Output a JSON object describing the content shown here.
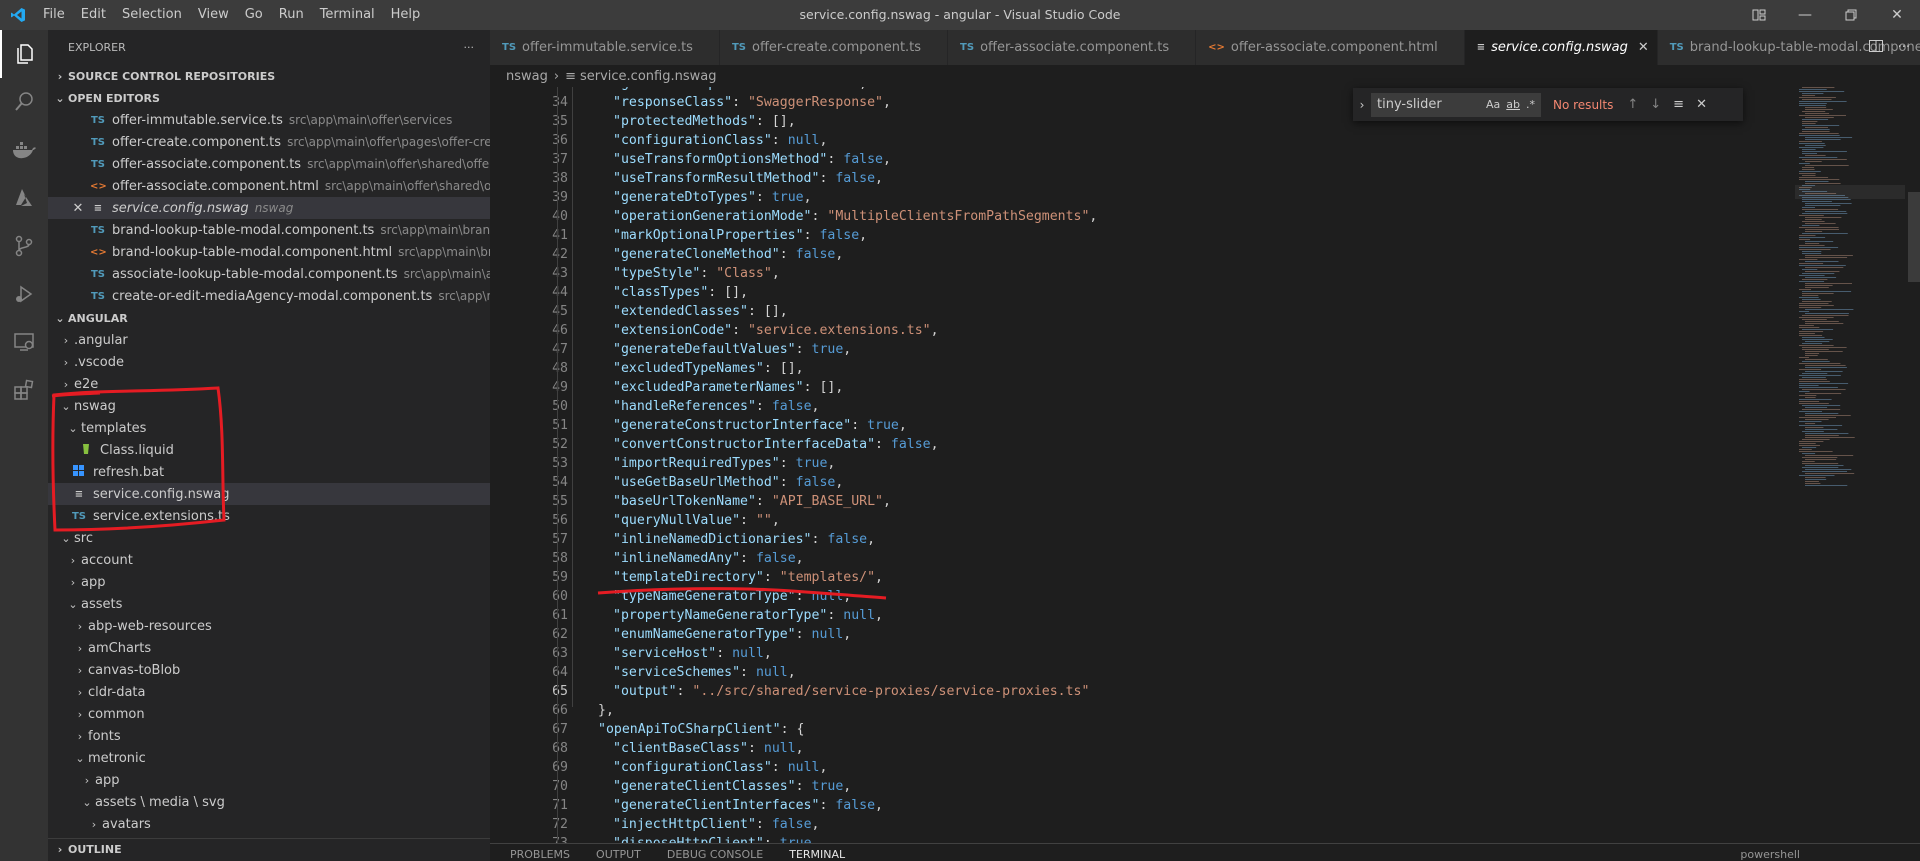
{
  "titlebar": {
    "menu": [
      "File",
      "Edit",
      "Selection",
      "View",
      "Go",
      "Run",
      "Terminal",
      "Help"
    ],
    "title": "service.config.nswag - angular - Visual Studio Code"
  },
  "sidebar": {
    "title": "EXPLORER",
    "more": "···",
    "sections": {
      "scm": "SOURCE CONTROL REPOSITORIES",
      "open_editors": "OPEN EDITORS",
      "workspace": "ANGULAR",
      "outline": "OUTLINE"
    },
    "open_editors": [
      {
        "icon": "TS",
        "name": "offer-immutable.service.ts",
        "path": "src\\app\\main\\offer\\services"
      },
      {
        "icon": "TS",
        "name": "offer-create.component.ts",
        "path": "src\\app\\main\\offer\\pages\\offer-create"
      },
      {
        "icon": "TS",
        "name": "offer-associate.component.ts",
        "path": "src\\app\\main\\offer\\shared\\offer-asso..."
      },
      {
        "icon": "<>",
        "name": "offer-associate.component.html",
        "path": "src\\app\\main\\offer\\shared\\offer-a..."
      },
      {
        "icon": "≡",
        "name": "service.config.nswag",
        "path": "nswag"
      },
      {
        "icon": "TS",
        "name": "brand-lookup-table-modal.component.ts",
        "path": "src\\app\\main\\brand\\sha..."
      },
      {
        "icon": "<>",
        "name": "brand-lookup-table-modal.component.html",
        "path": "src\\app\\main\\brand\\..."
      },
      {
        "icon": "TS",
        "name": "associate-lookup-table-modal.component.ts",
        "path": "src\\app\\main\\associ..."
      },
      {
        "icon": "TS",
        "name": "create-or-edit-mediaAgency-modal.component.ts",
        "path": "src\\app\\main\\..."
      }
    ],
    "tree": [
      {
        "depth": 0,
        "chev": "›",
        "label": ".angular"
      },
      {
        "depth": 0,
        "chev": "›",
        "label": ".vscode"
      },
      {
        "depth": 0,
        "chev": "›",
        "label": "e2e"
      },
      {
        "depth": 0,
        "chev": "⌄",
        "label": "nswag"
      },
      {
        "depth": 1,
        "chev": "⌄",
        "label": "templates"
      },
      {
        "depth": 2,
        "chev": "",
        "label": "Class.liquid",
        "icon": "liquid"
      },
      {
        "depth": 1,
        "chev": "",
        "label": "refresh.bat",
        "icon": "bat"
      },
      {
        "depth": 1,
        "chev": "",
        "label": "service.config.nswag",
        "icon": "cfg",
        "selected": true
      },
      {
        "depth": 1,
        "chev": "",
        "label": "service.extensions.ts",
        "icon": "ts"
      },
      {
        "depth": 0,
        "chev": "⌄",
        "label": "src"
      },
      {
        "depth": 1,
        "chev": "›",
        "label": "account"
      },
      {
        "depth": 1,
        "chev": "›",
        "label": "app"
      },
      {
        "depth": 1,
        "chev": "⌄",
        "label": "assets"
      },
      {
        "depth": 2,
        "chev": "›",
        "label": "abp-web-resources"
      },
      {
        "depth": 2,
        "chev": "›",
        "label": "amCharts"
      },
      {
        "depth": 2,
        "chev": "›",
        "label": "canvas-toBlob"
      },
      {
        "depth": 2,
        "chev": "›",
        "label": "cldr-data"
      },
      {
        "depth": 2,
        "chev": "›",
        "label": "common"
      },
      {
        "depth": 2,
        "chev": "›",
        "label": "fonts"
      },
      {
        "depth": 2,
        "chev": "⌄",
        "label": "metronic"
      },
      {
        "depth": 3,
        "chev": "›",
        "label": "app"
      },
      {
        "depth": 3,
        "chev": "⌄",
        "label": "assets \\ media \\ svg"
      },
      {
        "depth": 4,
        "chev": "›",
        "label": "avatars"
      }
    ]
  },
  "tabs": [
    {
      "icon": "TS",
      "label": "offer-immutable.service.ts"
    },
    {
      "icon": "TS",
      "label": "offer-create.component.ts"
    },
    {
      "icon": "TS",
      "label": "offer-associate.component.ts"
    },
    {
      "icon": "<>",
      "label": "offer-associate.component.html"
    },
    {
      "icon": "≡",
      "label": "service.config.nswag",
      "active": true
    },
    {
      "icon": "TS",
      "label": "brand-lookup-table-modal.component.ts"
    }
  ],
  "breadcrumbs": [
    "nswag",
    "service.config.nswag"
  ],
  "find": {
    "query": "tiny-slider",
    "opt_case": "Aa",
    "opt_word": "ab",
    "opt_regex": ".*",
    "result": "No results"
  },
  "editor": {
    "current_line": 65,
    "lines": [
      {
        "n": "33",
        "i": 1,
        "t": "\"generateResponseClasses\": true,"
      },
      {
        "n": "34",
        "i": 1,
        "t": "\"responseClass\": \"SwaggerResponse\","
      },
      {
        "n": "35",
        "i": 1,
        "t": "\"protectedMethods\": [],"
      },
      {
        "n": "36",
        "i": 1,
        "t": "\"configurationClass\": null,"
      },
      {
        "n": "37",
        "i": 1,
        "t": "\"useTransformOptionsMethod\": false,"
      },
      {
        "n": "38",
        "i": 1,
        "t": "\"useTransformResultMethod\": false,"
      },
      {
        "n": "39",
        "i": 1,
        "t": "\"generateDtoTypes\": true,"
      },
      {
        "n": "40",
        "i": 1,
        "t": "\"operationGenerationMode\": \"MultipleClientsFromPathSegments\","
      },
      {
        "n": "41",
        "i": 1,
        "t": "\"markOptionalProperties\": false,"
      },
      {
        "n": "42",
        "i": 1,
        "t": "\"generateCloneMethod\": false,"
      },
      {
        "n": "43",
        "i": 1,
        "t": "\"typeStyle\": \"Class\","
      },
      {
        "n": "44",
        "i": 1,
        "t": "\"classTypes\": [],"
      },
      {
        "n": "45",
        "i": 1,
        "t": "\"extendedClasses\": [],"
      },
      {
        "n": "46",
        "i": 1,
        "t": "\"extensionCode\": \"service.extensions.ts\","
      },
      {
        "n": "47",
        "i": 1,
        "t": "\"generateDefaultValues\": true,"
      },
      {
        "n": "48",
        "i": 1,
        "t": "\"excludedTypeNames\": [],"
      },
      {
        "n": "49",
        "i": 1,
        "t": "\"excludedParameterNames\": [],"
      },
      {
        "n": "50",
        "i": 1,
        "t": "\"handleReferences\": false,"
      },
      {
        "n": "51",
        "i": 1,
        "t": "\"generateConstructorInterface\": true,"
      },
      {
        "n": "52",
        "i": 1,
        "t": "\"convertConstructorInterfaceData\": false,"
      },
      {
        "n": "53",
        "i": 1,
        "t": "\"importRequiredTypes\": true,"
      },
      {
        "n": "54",
        "i": 1,
        "t": "\"useGetBaseUrlMethod\": false,"
      },
      {
        "n": "55",
        "i": 1,
        "t": "\"baseUrlTokenName\": \"API_BASE_URL\","
      },
      {
        "n": "56",
        "i": 1,
        "t": "\"queryNullValue\": \"\","
      },
      {
        "n": "57",
        "i": 1,
        "t": "\"inlineNamedDictionaries\": false,"
      },
      {
        "n": "58",
        "i": 1,
        "t": "\"inlineNamedAny\": false,"
      },
      {
        "n": "59",
        "i": 1,
        "t": "\"templateDirectory\": \"templates/\","
      },
      {
        "n": "60",
        "i": 1,
        "t": "\"typeNameGeneratorType\": null,"
      },
      {
        "n": "61",
        "i": 1,
        "t": "\"propertyNameGeneratorType\": null,"
      },
      {
        "n": "62",
        "i": 1,
        "t": "\"enumNameGeneratorType\": null,"
      },
      {
        "n": "63",
        "i": 1,
        "t": "\"serviceHost\": null,"
      },
      {
        "n": "64",
        "i": 1,
        "t": "\"serviceSchemes\": null,"
      },
      {
        "n": "65",
        "i": 1,
        "t": "\"output\": \"../src/shared/service-proxies/service-proxies.ts\""
      },
      {
        "n": "66",
        "i": 0,
        "t": "},"
      },
      {
        "n": "67",
        "i": 0,
        "t": "\"openApiToCSharpClient\": {"
      },
      {
        "n": "68",
        "i": 1,
        "t": "\"clientBaseClass\": null,"
      },
      {
        "n": "69",
        "i": 1,
        "t": "\"configurationClass\": null,"
      },
      {
        "n": "70",
        "i": 1,
        "t": "\"generateClientClasses\": true,"
      },
      {
        "n": "71",
        "i": 1,
        "t": "\"generateClientInterfaces\": false,"
      },
      {
        "n": "72",
        "i": 1,
        "t": "\"injectHttpClient\": false,"
      },
      {
        "n": "73",
        "i": 1,
        "t": "\"disposeHttpClient\": true,"
      }
    ]
  },
  "panel": {
    "tabs": [
      "PROBLEMS",
      "OUTPUT",
      "DEBUG CONSOLE",
      "TERMINAL"
    ],
    "active": "TERMINAL",
    "shell": "powershell"
  },
  "colors": {
    "accent": "#007acc",
    "annotation": "#e51c23"
  }
}
